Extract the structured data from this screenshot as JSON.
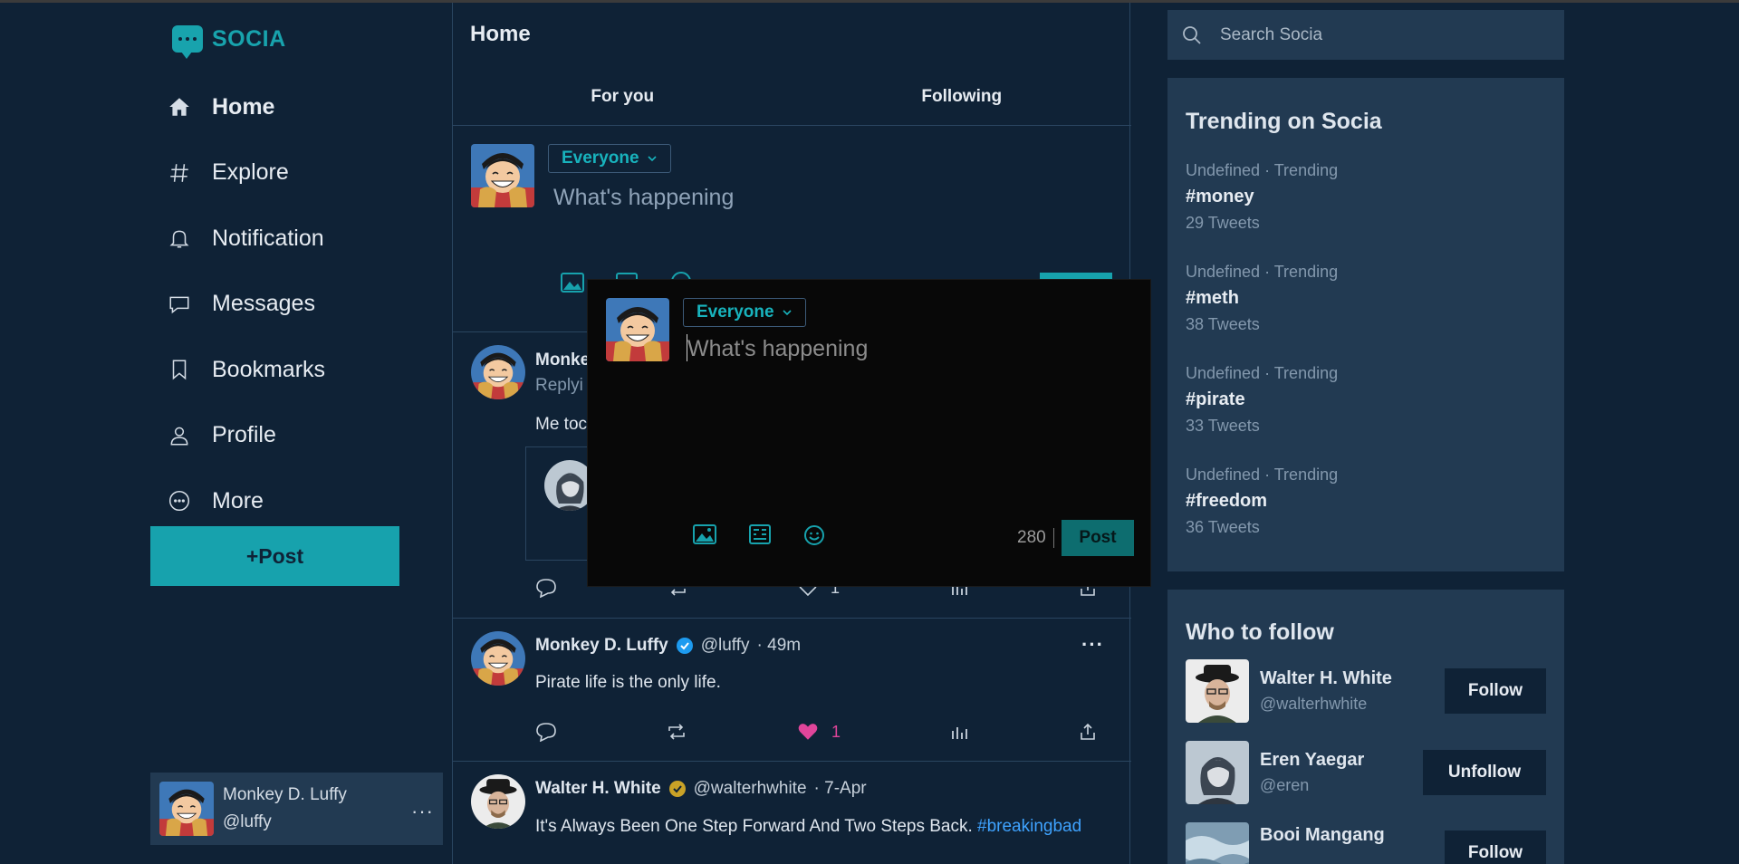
{
  "app": {
    "name": "SOCIA"
  },
  "sidebar": {
    "items": [
      {
        "label": "Home",
        "icon": "home-icon"
      },
      {
        "label": "Explore",
        "icon": "hash-icon"
      },
      {
        "label": "Notification",
        "icon": "bell-icon"
      },
      {
        "label": "Messages",
        "icon": "message-icon"
      },
      {
        "label": "Bookmarks",
        "icon": "bookmark-icon"
      },
      {
        "label": "Profile",
        "icon": "user-icon"
      },
      {
        "label": "More",
        "icon": "more-circle-icon"
      }
    ],
    "post_button": "+Post",
    "current_user": {
      "name": "Monkey D. Luffy",
      "handle": "@luffy"
    }
  },
  "feed": {
    "title": "Home",
    "tabs": [
      "For you",
      "Following"
    ],
    "composer": {
      "audience": "Everyone",
      "placeholder": "What's happening"
    },
    "tweets": [
      {
        "author": "Monke",
        "handle": "Replyi",
        "text": "Me toc",
        "likes": "1"
      },
      {
        "author": "Monkey D. Luffy",
        "handle": "@luffy",
        "time": "· 49m",
        "text": "Pirate life is the only life.",
        "likes": "1"
      },
      {
        "author": "Walter H. White",
        "handle": "@walterhwhite",
        "time": "· 7-Apr",
        "text": "It's Always Been One Step Forward And Two Steps Back.",
        "hashtag": "#breakingbad"
      }
    ]
  },
  "modal": {
    "audience": "Everyone",
    "placeholder": "What's happening",
    "char_count": "280",
    "post_label": "Post"
  },
  "search": {
    "placeholder": "Search Socia"
  },
  "trending": {
    "title": "Trending on Socia",
    "items": [
      {
        "meta": "Undefined · Trending",
        "tag": "#money",
        "count": "29 Tweets"
      },
      {
        "meta": "Undefined · Trending",
        "tag": "#meth",
        "count": "38 Tweets"
      },
      {
        "meta": "Undefined · Trending",
        "tag": "#pirate",
        "count": "33 Tweets"
      },
      {
        "meta": "Undefined · Trending",
        "tag": "#freedom",
        "count": "36 Tweets"
      }
    ]
  },
  "who_to_follow": {
    "title": "Who to follow",
    "users": [
      {
        "name": "Walter H. White",
        "handle": "@walterhwhite",
        "button": "Follow"
      },
      {
        "name": "Eren Yaegar",
        "handle": "@eren",
        "button": "Unfollow"
      },
      {
        "name": "Booi Mangang",
        "handle": "",
        "button": "Follow"
      }
    ]
  },
  "colors": {
    "accent": "#17a2ad",
    "background": "#0f2236",
    "panel": "#223a52",
    "like": "#e0459a",
    "link": "#3fa3ff",
    "verified_blue": "#1d9bf0",
    "verified_gold": "#c9a227"
  }
}
